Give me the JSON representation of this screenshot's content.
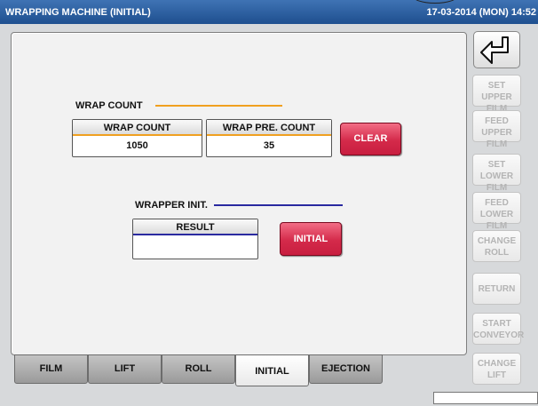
{
  "titlebar": {
    "title": "WRAPPING MACHINE (INITIAL)",
    "datetime": "17-03-2014 (MON) 14:52"
  },
  "wrap_count_section": {
    "label": "WRAP COUNT",
    "wrap_count_header": "WRAP COUNT",
    "wrap_count_value": "1050",
    "wrap_pre_count_header": "WRAP PRE. COUNT",
    "wrap_pre_count_value": "35",
    "clear_label": "CLEAR"
  },
  "wrapper_init_section": {
    "label": "WRAPPER INIT.",
    "result_header": "RESULT",
    "result_value": "",
    "initial_label": "INITIAL"
  },
  "tabs": [
    {
      "label": "FILM",
      "active": false
    },
    {
      "label": "LIFT",
      "active": false
    },
    {
      "label": "ROLL",
      "active": false
    },
    {
      "label": "INITIAL",
      "active": true
    },
    {
      "label": "EJECTION",
      "active": false
    }
  ],
  "sidebar": {
    "back_icon": "return-arrow-icon",
    "buttons": [
      {
        "label": "SET\nUPPER FILM",
        "enabled": false
      },
      {
        "label": "FEED\nUPPER FILM",
        "enabled": false
      },
      {
        "label": "SET\nLOWER FILM",
        "enabled": false
      },
      {
        "label": "FEED\nLOWER FILM",
        "enabled": false
      },
      {
        "label": "CHANGE\nROLL",
        "enabled": false
      },
      {
        "label": "RETURN",
        "enabled": false
      },
      {
        "label": "START\nCONVEYOR",
        "enabled": false
      },
      {
        "label": "CHANGE\nLIFT",
        "enabled": false
      }
    ]
  },
  "colors": {
    "title_bar": "#2a5fa5",
    "accent_orange": "#f0a020",
    "accent_blue": "#2a2aa0",
    "action_red": "#d42a4a"
  }
}
